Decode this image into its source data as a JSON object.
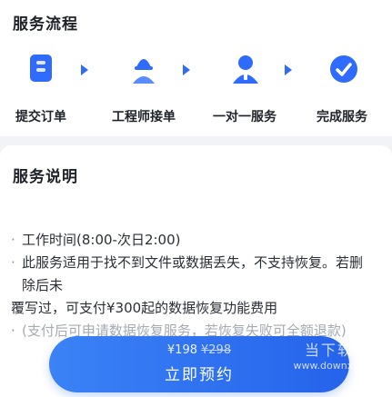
{
  "process": {
    "title": "服务流程",
    "steps": [
      {
        "label": "提交订单",
        "icon": "document-icon"
      },
      {
        "label": "工程师接单",
        "icon": "engineer-icon"
      },
      {
        "label": "一对一服务",
        "icon": "user-icon"
      },
      {
        "label": "完成服务",
        "icon": "complete-icon"
      }
    ],
    "arrow_icon": "chevron-right-icon"
  },
  "description": {
    "title": "服务说明",
    "items": [
      "工作时间(8:00-次日2:00)",
      "此服务适用于找不到文件或数据丢失，不支持恢复。若删除后未",
      "覆写过，可支付¥300起的数据恢复功能费用",
      "(支付后可申请数据恢复服务，若恢复失败可全额退款)"
    ]
  },
  "booking": {
    "price": "¥198",
    "old_price": "¥298",
    "button_label": "立即预约"
  },
  "watermark": {
    "line1": "当下软件园",
    "line2": "www.downxia.com"
  },
  "colors": {
    "accent": "#2f6bff",
    "button": "#2563eb",
    "icon_light": "#5b8cff"
  }
}
